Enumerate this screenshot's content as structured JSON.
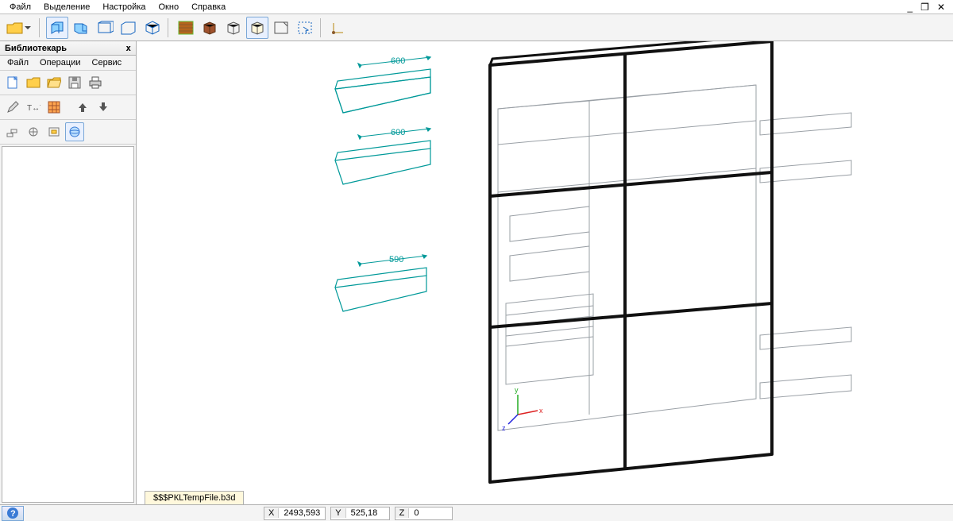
{
  "menu": {
    "items": [
      "Файл",
      "Выделение",
      "Настройка",
      "Окно",
      "Справка"
    ]
  },
  "window_controls": {
    "min": "_",
    "restore": "❐",
    "close": "✕"
  },
  "panel": {
    "title": "Библиотекарь",
    "close": "x",
    "menu": [
      "Файл",
      "Операции",
      "Сервис"
    ]
  },
  "tab": {
    "label": "$$$PКLTempFile.b3d"
  },
  "status": {
    "coords": [
      {
        "label": "X",
        "value": "2493,593"
      },
      {
        "label": "Y",
        "value": "525,18"
      },
      {
        "label": "Z",
        "value": "0"
      }
    ]
  },
  "dims": {
    "shelf1": "600",
    "shelf2": "600",
    "shelf3": "590"
  },
  "colors": {
    "dim": "#009999",
    "frame": "#111111",
    "wire": "#9aa0a6",
    "axis_x": "#d22",
    "axis_y": "#2a2",
    "axis_z": "#22d"
  }
}
